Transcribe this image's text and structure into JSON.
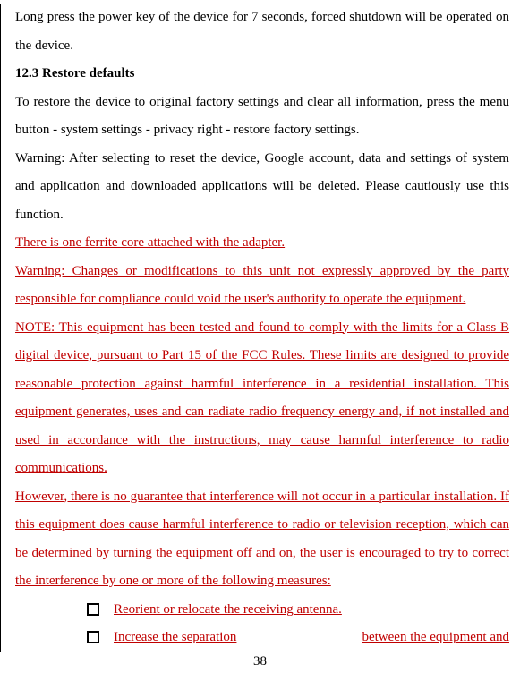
{
  "p1": "Long press the power key of the device for 7 seconds, forced shutdown will be operated on the device.",
  "h1": "12.3 Restore defaults",
  "p2": "To restore the device to original factory settings and clear all information, press the menu button - system settings - privacy right - restore factory settings.",
  "p3": "Warning: After selecting to reset the device, Google account, data and settings of system and application and downloaded applications will be deleted. Please cautiously use this function.",
  "r1": "There is one ferrite core attached with the adapter.  ",
  "r2": "Warning:  Changes or modifications to this unit not expressly approved by the party responsible for compliance could void the user's authority to operate the equipment.",
  "r3": "NOTE:  This equipment has been tested and found to comply with the limits for a Class B digital device, pursuant to Part 15 of the FCC Rules.  These limits are designed to provide reasonable protection against harmful interference in a residential installation.  This equipment generates, uses and can radiate radio frequency energy and, if not installed and used in accordance with the instructions, may cause harmful interference to radio communications.",
  "r4": "However, there is no guarantee that interference will not occur in a particular installation.  If this equipment does cause harmful interference to radio or television reception, which can be determined by turning the equipment off and on, the user is encouraged to try to correct the interference by one or more of the following measures:",
  "li1": "Reorient or relocate the receiving antenna.",
  "li2a": "Increase the separation",
  "li2b": "between the equipment and ",
  "page": "38"
}
